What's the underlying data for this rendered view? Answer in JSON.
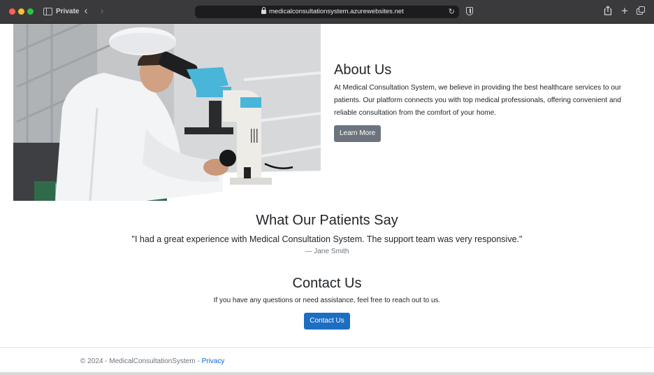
{
  "browser": {
    "private_label": "Private",
    "url": "medicalconsultationsystem.azurewebsites.net",
    "icons": [
      "sidebar-toggle-icon",
      "back-icon",
      "forward-icon",
      "lock-icon",
      "reload-icon",
      "shield-icon",
      "share-icon",
      "new-tab-icon",
      "tab-overview-icon"
    ]
  },
  "about": {
    "heading": "About Us",
    "body": "At Medical Consultation System, we believe in providing the best healthcare services to our patients. Our platform connects you with top medical professionals, offering convenient and reliable consultation from the comfort of your home.",
    "button_label": "Learn More"
  },
  "testimonials": {
    "heading": "What Our Patients Say",
    "quote": "\"I had a great experience with Medical Consultation System. The support team was very responsive.\"",
    "author": "— Jane Smith"
  },
  "contact": {
    "heading": "Contact Us",
    "body": "If you have any questions or need assistance, feel free to reach out to us.",
    "button_label": "Contact Us"
  },
  "footer": {
    "copyright": "© 2024 - MedicalConsultationSystem - ",
    "privacy_link": "Privacy"
  },
  "colors": {
    "primary_button": "#1b6ec2",
    "secondary_button": "#6c757d",
    "link": "#0366d6"
  }
}
